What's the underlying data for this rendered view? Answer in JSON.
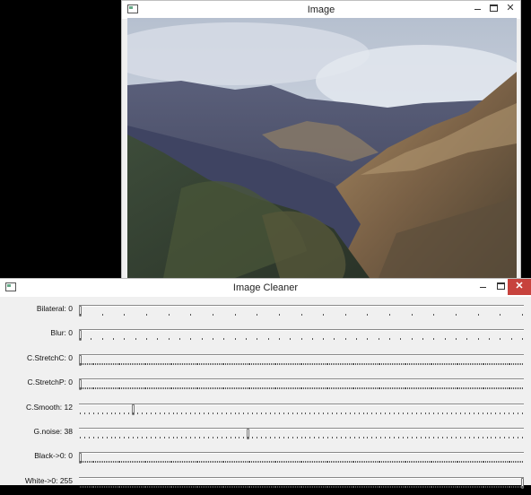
{
  "image_window": {
    "title": "Image",
    "controls": {
      "minimize": "–",
      "maximize": "□",
      "close": "✕"
    }
  },
  "cleaner_window": {
    "title": "Image Cleaner",
    "controls": {
      "minimize": "–",
      "maximize": "□",
      "close": "✕"
    },
    "sliders": [
      {
        "label": "Bilateral: 0",
        "value": 0,
        "max": 20,
        "tick_step": 1
      },
      {
        "label": "Blur: 0",
        "value": 0,
        "max": 40,
        "tick_step": 1
      },
      {
        "label": "C.StretchC: 0",
        "value": 0,
        "max": 255,
        "tick_step": 1
      },
      {
        "label": "C.StretchP: 0",
        "value": 0,
        "max": 255,
        "tick_step": 1
      },
      {
        "label": "C.Smooth: 12",
        "value": 12,
        "max": 100,
        "tick_step": 1
      },
      {
        "label": "G.noise: 38",
        "value": 38,
        "max": 100,
        "tick_step": 1
      },
      {
        "label": "Black->0: 0",
        "value": 0,
        "max": 255,
        "tick_step": 1
      },
      {
        "label": "White->0: 255",
        "value": 255,
        "max": 255,
        "tick_step": 1
      }
    ]
  },
  "colors": {
    "desktop": "#000000",
    "window_bg": "#f0f0f0",
    "close_button": "#c7423d"
  }
}
